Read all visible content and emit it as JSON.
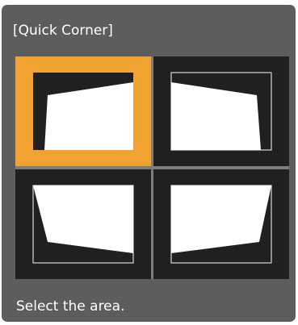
{
  "dialog": {
    "title": "[Quick Corner]",
    "instruction": "Select the area."
  },
  "areas": [
    {
      "name": "top-left",
      "selected": true
    },
    {
      "name": "top-right",
      "selected": false
    },
    {
      "name": "bottom-left",
      "selected": false
    },
    {
      "name": "bottom-right",
      "selected": false
    }
  ],
  "colors": {
    "panel": "#5d5d5d",
    "selected": "#f2a230",
    "cell": "#202020",
    "screen_fill": "#ffffff",
    "text": "#ffffff"
  }
}
